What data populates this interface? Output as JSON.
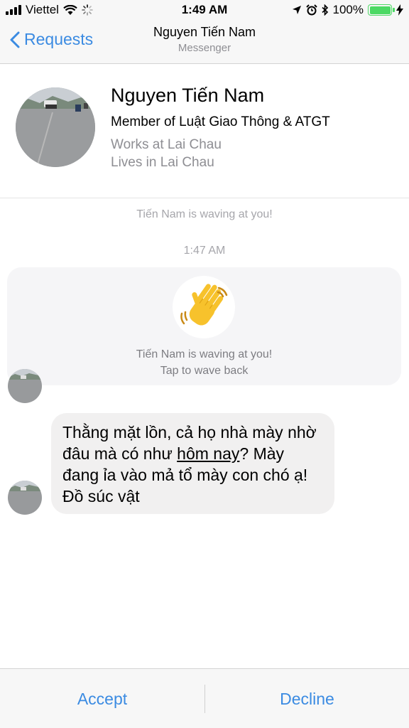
{
  "status_bar": {
    "carrier": "Viettel",
    "time": "1:49 AM",
    "battery": "100%",
    "battery_level": 1.0,
    "icons": [
      "signal-icon",
      "wifi-icon",
      "loading-icon",
      "location-icon",
      "alarm-icon",
      "bluetooth-icon",
      "battery-icon",
      "charging-icon"
    ]
  },
  "nav": {
    "back_label": "Requests",
    "title": "Nguyen Tiến Nam",
    "subtitle": "Messenger"
  },
  "profile": {
    "name": "Nguyen Tiến Nam",
    "member": "Member of Luật Giao Thông & ATGT",
    "works": "Works at Lai Chau",
    "lives": "Lives in Lai Chau"
  },
  "conversation": {
    "waving_note": "Tiến Nam is waving at you!",
    "timestamp": "1:47 AM",
    "wave_card": {
      "text": "Tiến Nam is waving at you!",
      "action": "Tap to wave back"
    },
    "message": {
      "part1": "Thằng mặt lồn, cả họ nhà mày nhờ đâu mà có như ",
      "link": "hôm nay",
      "part2": "? Mày đang ỉa vào mả tổ mày con chó ạ! Đồ súc vật"
    }
  },
  "actions": {
    "accept": "Accept",
    "decline": "Decline"
  },
  "colors": {
    "accent": "#3b8be2",
    "battery": "#4cd964",
    "bubble": "#f1f0f0"
  }
}
